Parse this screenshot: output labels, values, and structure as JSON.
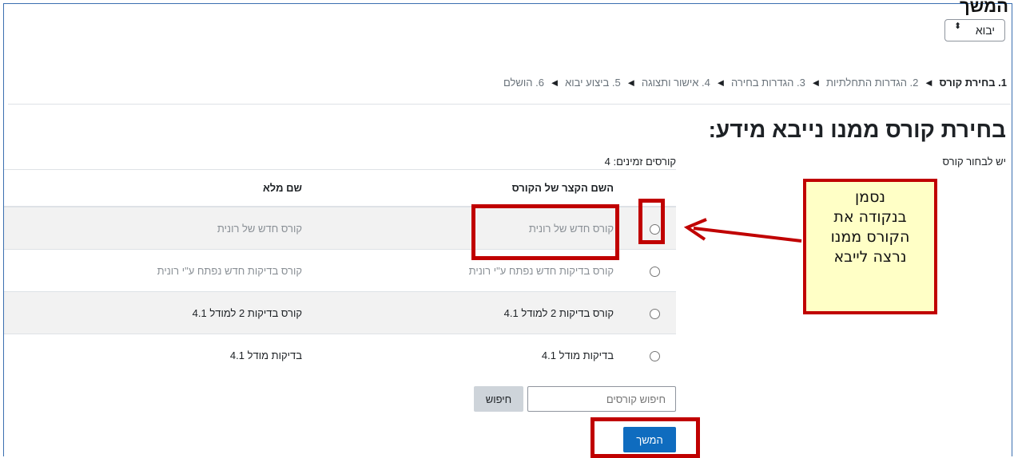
{
  "page": {
    "top_title": "המשך",
    "import_select": {
      "label": "יבוא",
      "arrow": "⬍"
    }
  },
  "steps": {
    "current": "1. בחירת קורס",
    "items": [
      "2. הגדרות התחלתיות",
      "3. הגדרות בחירה",
      "4. אישור ותצוגה",
      "5. ביצוע יבוא",
      "6. הושלם"
    ],
    "separator": "◄"
  },
  "main": {
    "heading": "בחירת קורס ממנו נייבא מידע:",
    "must_select": "יש לבחור קורס",
    "course_count": "קורסים זמינים: 4"
  },
  "table": {
    "headers": {
      "short": "השם הקצר של הקורס",
      "full": "שם מלא"
    },
    "rows": [
      {
        "short": "קורס חדש של רונית",
        "full": "קורס חדש של רונית"
      },
      {
        "short": "קורס בדיקות חדש נפתח ע\"י רונית",
        "full": "קורס בדיקות חדש נפתח ע\"י רונית"
      },
      {
        "short": "קורס בדיקות 2 למודל 4.1",
        "full": "קורס בדיקות 2 למודל 4.1"
      },
      {
        "short": "בדיקות מודל 4.1",
        "full": "בדיקות מודל 4.1"
      }
    ]
  },
  "search": {
    "placeholder": "חיפוש קורסים",
    "button": "חיפוש"
  },
  "continue_button": "המשך",
  "annotation": {
    "callout_lines": [
      "נסמן",
      "בנקודה את",
      "הקורס ממנו",
      "נרצה לייבא"
    ],
    "color": "#c00000",
    "callout_bg": "#ffffc6"
  }
}
